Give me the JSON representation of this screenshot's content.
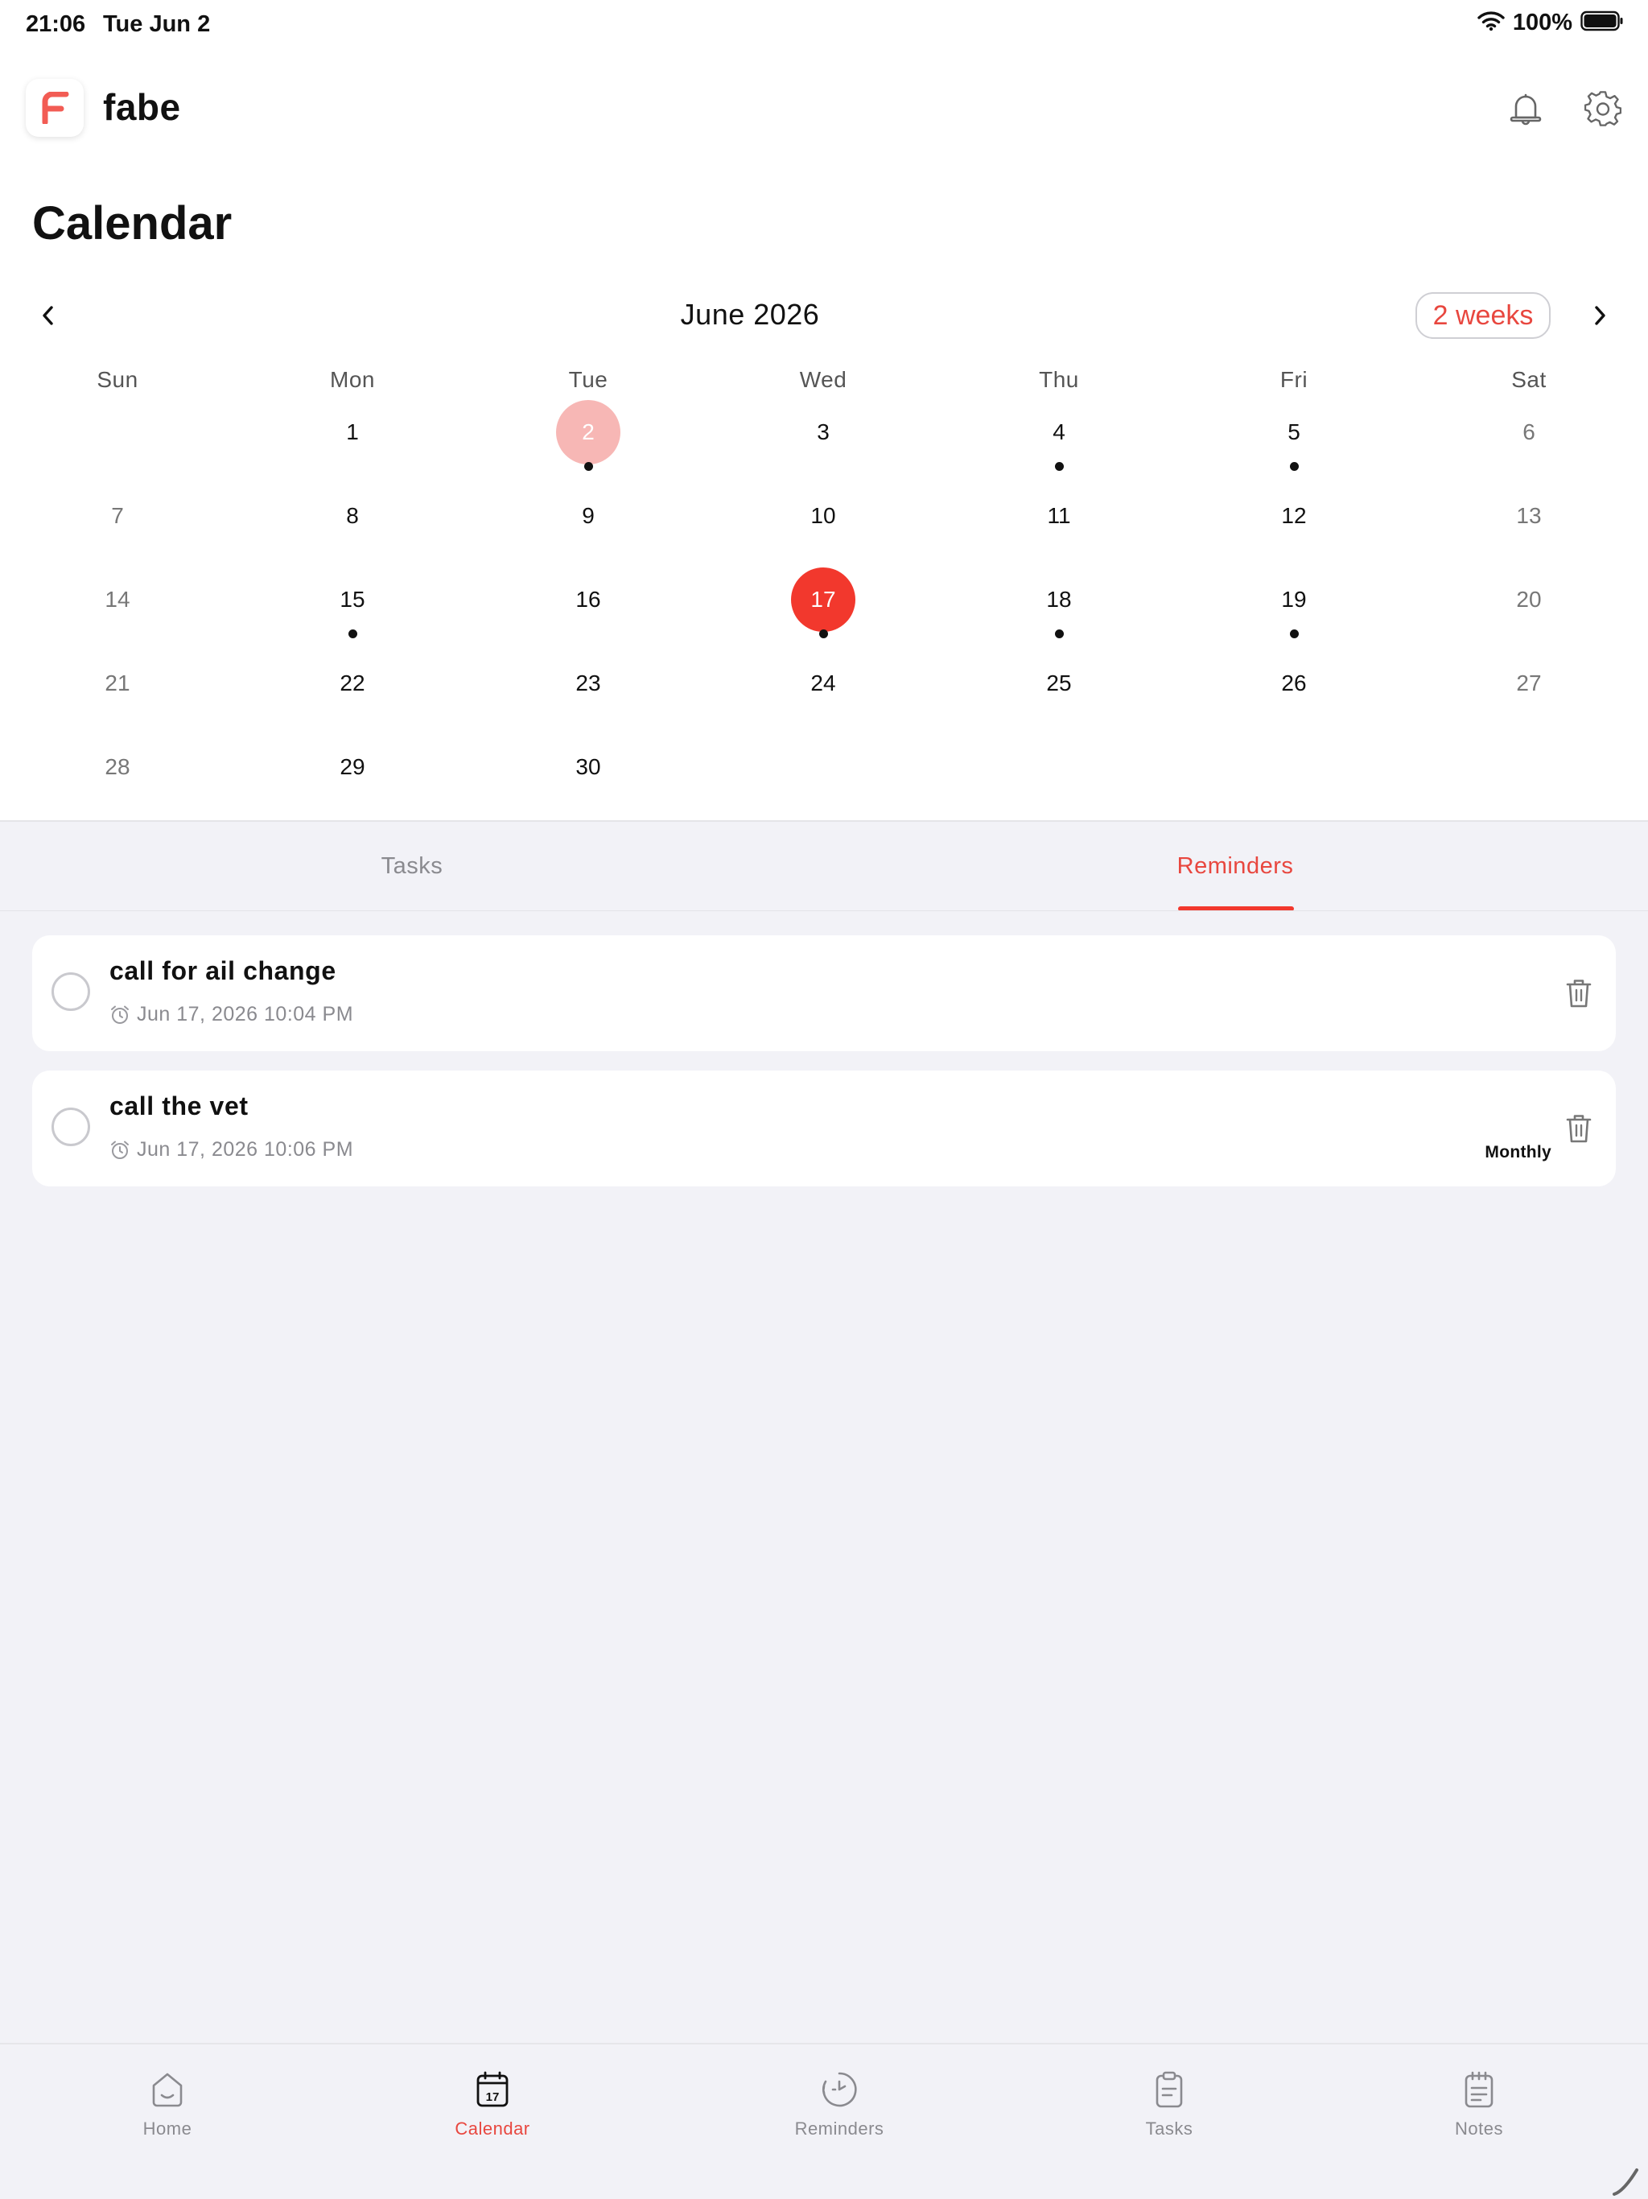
{
  "status_bar": {
    "time": "21:06",
    "date": "Tue Jun 2",
    "battery": "100%"
  },
  "header": {
    "app_name": "fabe",
    "logo_letter": "F",
    "icons": [
      "bell-icon",
      "gear-icon"
    ]
  },
  "page": {
    "title": "Calendar"
  },
  "calendar": {
    "month_label": "June 2026",
    "range_button": "2 weeks",
    "weekdays": [
      "Sun",
      "Mon",
      "Tue",
      "Wed",
      "Thu",
      "Fri",
      "Sat"
    ],
    "weeks": [
      [
        "",
        "1",
        "2",
        "3",
        "4",
        "5",
        "6"
      ],
      [
        "7",
        "8",
        "9",
        "10",
        "11",
        "12",
        "13"
      ],
      [
        "14",
        "15",
        "16",
        "17",
        "18",
        "19",
        "20"
      ],
      [
        "21",
        "22",
        "23",
        "24",
        "25",
        "26",
        "27"
      ],
      [
        "28",
        "29",
        "30",
        "",
        "",
        "",
        ""
      ]
    ],
    "today": "2",
    "selected": "17",
    "days_with_events": [
      "2",
      "4",
      "5",
      "15",
      "17",
      "18",
      "19"
    ],
    "colors": {
      "accent": "#f2382d",
      "today_bg": "#f7b7b5"
    }
  },
  "tabs": {
    "items": [
      {
        "label": "Tasks",
        "active": false
      },
      {
        "label": "Reminders",
        "active": true
      }
    ]
  },
  "reminders": [
    {
      "title": "call for ail change",
      "datetime": "Jun 17, 2026 10:04 PM",
      "repeat": ""
    },
    {
      "title": "call the vet",
      "datetime": "Jun 17, 2026 10:06 PM",
      "repeat": "Monthly"
    }
  ],
  "bottom_nav": {
    "items": [
      {
        "label": "Home",
        "icon": "home-icon",
        "active": false
      },
      {
        "label": "Calendar",
        "icon": "calendar-icon",
        "active": true
      },
      {
        "label": "Reminders",
        "icon": "reminder-clock-icon",
        "active": false
      },
      {
        "label": "Tasks",
        "icon": "clipboard-icon",
        "active": false
      },
      {
        "label": "Notes",
        "icon": "notepad-icon",
        "active": false
      }
    ]
  }
}
